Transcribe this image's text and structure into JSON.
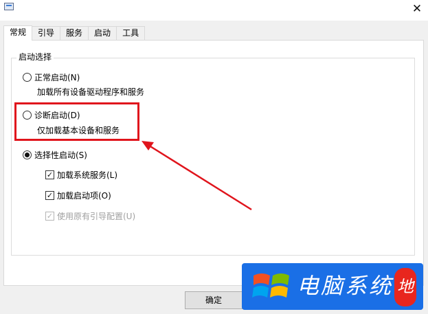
{
  "window": {
    "close_glyph": "✕"
  },
  "tabs": [
    {
      "label": "常规",
      "active": true
    },
    {
      "label": "引导",
      "active": false
    },
    {
      "label": "服务",
      "active": false
    },
    {
      "label": "启动",
      "active": false
    },
    {
      "label": "工具",
      "active": false
    }
  ],
  "startup_selection": {
    "title": "启动选择",
    "normal": {
      "label": "正常启动(N)",
      "description": "加载所有设备驱动程序和服务",
      "selected": false
    },
    "diagnostic": {
      "label": "诊断启动(D)",
      "description": "仅加载基本设备和服务",
      "selected": false
    },
    "selective": {
      "label": "选择性启动(S)",
      "selected": true,
      "options": [
        {
          "label": "加载系统服务(L)",
          "checked": true,
          "enabled": true
        },
        {
          "label": "加载启动项(O)",
          "checked": true,
          "enabled": true
        },
        {
          "label": "使用原有引导配置(U)",
          "checked": true,
          "enabled": false
        }
      ]
    }
  },
  "annotation": {
    "highlight_color": "#e0141c"
  },
  "buttons": {
    "ok_label": "确定"
  },
  "watermark": {
    "text": "电脑系统",
    "badge": "地",
    "color": "#1a6fe6"
  }
}
